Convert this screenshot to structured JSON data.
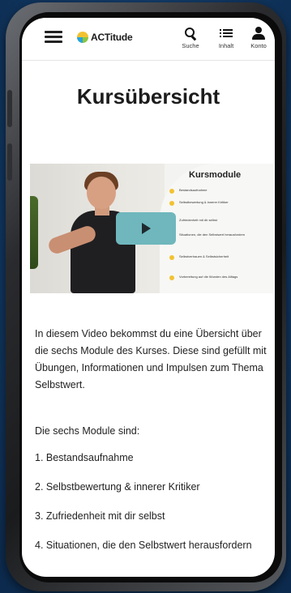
{
  "app": {
    "logo_text": "ACTitude",
    "accent": "#6fb7bd"
  },
  "header": {
    "nav": [
      {
        "label": "Suche",
        "icon": "search-icon"
      },
      {
        "label": "Inhalt",
        "icon": "list-icon"
      },
      {
        "label": "Konto",
        "icon": "user-icon"
      }
    ]
  },
  "page": {
    "title": "Kursübersicht",
    "video": {
      "panel_title": "Kursmodule",
      "modules": [
        "Bestandsaufnahme",
        "Selbstbewertung & innerer Kritiker",
        "Zufriedenheit mit dir selbst",
        "Situationen, die den Selbstwert herausfordern",
        "Selbstvertrauen & Selbstsicherheit",
        "Vorbereitung auf die Wunden des Alltags"
      ]
    },
    "intro": "In diesem Video bekommst du eine Übersicht über die sechs Module des Kurses. Diese sind gefüllt mit Übungen, Informationen und Impulsen zum Thema Selbstwert.",
    "subheading": "Die sechs Module sind:",
    "module_list": [
      "1. Bestandsaufnahme",
      "2. Selbstbewertung & innerer Kritiker",
      "3. Zufriedenheit mit dir selbst",
      "4. Situationen, die den Selbstwert herausfordern"
    ]
  }
}
